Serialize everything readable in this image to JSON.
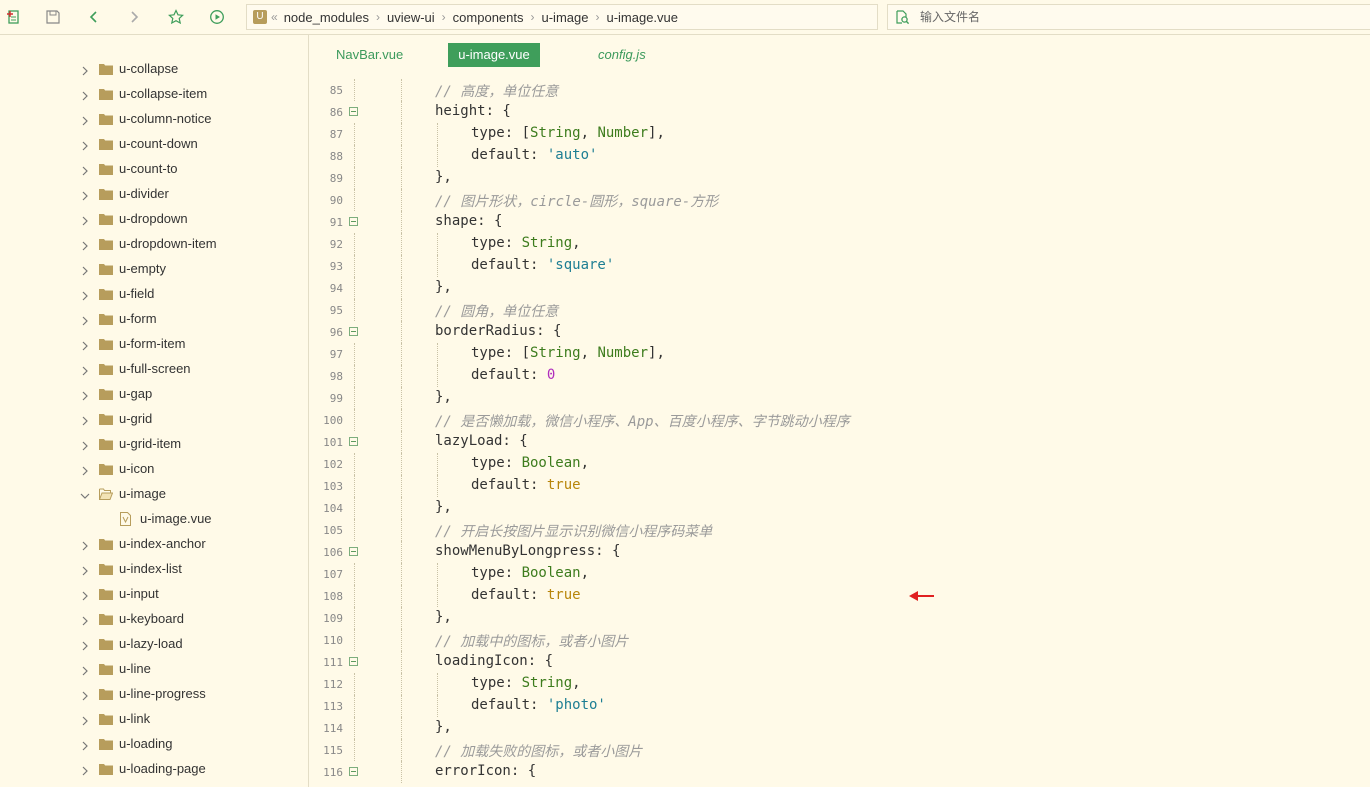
{
  "toolbar": {
    "icons": [
      "new-file-icon",
      "save-icon",
      "back-icon",
      "forward-icon",
      "favorite-icon",
      "run-icon"
    ]
  },
  "breadcrumb": {
    "icon": "u-logo-icon",
    "lead": "«",
    "items": [
      "node_modules",
      "uview-ui",
      "components",
      "u-image",
      "u-image.vue"
    ]
  },
  "search": {
    "placeholder": "输入文件名",
    "value": ""
  },
  "colors": {
    "background": "#fffae8",
    "active_tab": "#3f9e5b",
    "tab_text": "#3c9a5c",
    "comment": "#9a9a9a",
    "type": "#3d7c1d",
    "string": "#1d7e93",
    "boolean": "#b8860b",
    "number": "#b02dbd",
    "arrow": "#e02020"
  },
  "sidebar": {
    "items": [
      {
        "label": "u-collapse"
      },
      {
        "label": "u-collapse-item"
      },
      {
        "label": "u-column-notice"
      },
      {
        "label": "u-count-down"
      },
      {
        "label": "u-count-to"
      },
      {
        "label": "u-divider"
      },
      {
        "label": "u-dropdown"
      },
      {
        "label": "u-dropdown-item"
      },
      {
        "label": "u-empty"
      },
      {
        "label": "u-field"
      },
      {
        "label": "u-form"
      },
      {
        "label": "u-form-item"
      },
      {
        "label": "u-full-screen"
      },
      {
        "label": "u-gap"
      },
      {
        "label": "u-grid"
      },
      {
        "label": "u-grid-item"
      },
      {
        "label": "u-icon"
      },
      {
        "label": "u-image",
        "expanded": true
      },
      {
        "label": "u-image.vue",
        "file": true
      },
      {
        "label": "u-index-anchor"
      },
      {
        "label": "u-index-list"
      },
      {
        "label": "u-input"
      },
      {
        "label": "u-keyboard"
      },
      {
        "label": "u-lazy-load"
      },
      {
        "label": "u-line"
      },
      {
        "label": "u-line-progress"
      },
      {
        "label": "u-link"
      },
      {
        "label": "u-loading"
      },
      {
        "label": "u-loading-page"
      }
    ]
  },
  "tabs": [
    {
      "label": "NavBar.vue",
      "active": false
    },
    {
      "label": "u-image.vue",
      "active": true
    },
    {
      "label": "config.js",
      "active": false,
      "italic": true
    }
  ],
  "code": [
    {
      "n": "85",
      "fold": false,
      "indent": 1,
      "tokens": [
        {
          "t": "// 高度，单位任意",
          "c": "cm"
        }
      ]
    },
    {
      "n": "86",
      "fold": true,
      "indent": 1,
      "tokens": [
        {
          "t": "height: {"
        }
      ]
    },
    {
      "n": "87",
      "fold": false,
      "indent": 2,
      "tokens": [
        {
          "t": "type: ["
        },
        {
          "t": "String",
          "c": "ty"
        },
        {
          "t": ", "
        },
        {
          "t": "Number",
          "c": "ty"
        },
        {
          "t": "],"
        }
      ]
    },
    {
      "n": "88",
      "fold": false,
      "indent": 2,
      "tokens": [
        {
          "t": "default: "
        },
        {
          "t": "'auto'",
          "c": "st"
        }
      ]
    },
    {
      "n": "89",
      "fold": false,
      "indent": 1,
      "tokens": [
        {
          "t": "},"
        }
      ]
    },
    {
      "n": "90",
      "fold": false,
      "indent": 1,
      "tokens": [
        {
          "t": "// 图片形状，circle-圆形，square-方形",
          "c": "cm"
        }
      ]
    },
    {
      "n": "91",
      "fold": true,
      "indent": 1,
      "tokens": [
        {
          "t": "shape: {"
        }
      ]
    },
    {
      "n": "92",
      "fold": false,
      "indent": 2,
      "tokens": [
        {
          "t": "type: "
        },
        {
          "t": "String",
          "c": "ty"
        },
        {
          "t": ","
        }
      ]
    },
    {
      "n": "93",
      "fold": false,
      "indent": 2,
      "tokens": [
        {
          "t": "default: "
        },
        {
          "t": "'square'",
          "c": "st"
        }
      ]
    },
    {
      "n": "94",
      "fold": false,
      "indent": 1,
      "tokens": [
        {
          "t": "},"
        }
      ]
    },
    {
      "n": "95",
      "fold": false,
      "indent": 1,
      "tokens": [
        {
          "t": "// 圆角，单位任意",
          "c": "cm"
        }
      ]
    },
    {
      "n": "96",
      "fold": true,
      "indent": 1,
      "tokens": [
        {
          "t": "borderRadius: {"
        }
      ]
    },
    {
      "n": "97",
      "fold": false,
      "indent": 2,
      "tokens": [
        {
          "t": "type: ["
        },
        {
          "t": "String",
          "c": "ty"
        },
        {
          "t": ", "
        },
        {
          "t": "Number",
          "c": "ty"
        },
        {
          "t": "],"
        }
      ]
    },
    {
      "n": "98",
      "fold": false,
      "indent": 2,
      "tokens": [
        {
          "t": "default: "
        },
        {
          "t": "0",
          "c": "nu"
        }
      ]
    },
    {
      "n": "99",
      "fold": false,
      "indent": 1,
      "tokens": [
        {
          "t": "},"
        }
      ]
    },
    {
      "n": "100",
      "fold": false,
      "indent": 1,
      "tokens": [
        {
          "t": "// 是否懒加载，微信小程序、App、百度小程序、字节跳动小程序",
          "c": "cm"
        }
      ]
    },
    {
      "n": "101",
      "fold": true,
      "indent": 1,
      "tokens": [
        {
          "t": "lazyLoad: {"
        }
      ]
    },
    {
      "n": "102",
      "fold": false,
      "indent": 2,
      "tokens": [
        {
          "t": "type: "
        },
        {
          "t": "Boolean",
          "c": "ty"
        },
        {
          "t": ","
        }
      ]
    },
    {
      "n": "103",
      "fold": false,
      "indent": 2,
      "tokens": [
        {
          "t": "default: "
        },
        {
          "t": "true",
          "c": "bo"
        }
      ]
    },
    {
      "n": "104",
      "fold": false,
      "indent": 1,
      "tokens": [
        {
          "t": "},"
        }
      ]
    },
    {
      "n": "105",
      "fold": false,
      "indent": 1,
      "tokens": [
        {
          "t": "// 开启长按图片显示识别微信小程序码菜单",
          "c": "cm"
        }
      ]
    },
    {
      "n": "106",
      "fold": true,
      "indent": 1,
      "tokens": [
        {
          "t": "showMenuByLongpress: {"
        }
      ]
    },
    {
      "n": "107",
      "fold": false,
      "indent": 2,
      "tokens": [
        {
          "t": "type: "
        },
        {
          "t": "Boolean",
          "c": "ty"
        },
        {
          "t": ","
        }
      ]
    },
    {
      "n": "108",
      "fold": false,
      "indent": 2,
      "arrow": true,
      "tokens": [
        {
          "t": "default: "
        },
        {
          "t": "true",
          "c": "bo"
        }
      ]
    },
    {
      "n": "109",
      "fold": false,
      "indent": 1,
      "tokens": [
        {
          "t": "},"
        }
      ]
    },
    {
      "n": "110",
      "fold": false,
      "indent": 1,
      "tokens": [
        {
          "t": "// 加载中的图标，或者小图片",
          "c": "cm"
        }
      ]
    },
    {
      "n": "111",
      "fold": true,
      "indent": 1,
      "tokens": [
        {
          "t": "loadingIcon: {"
        }
      ]
    },
    {
      "n": "112",
      "fold": false,
      "indent": 2,
      "tokens": [
        {
          "t": "type: "
        },
        {
          "t": "String",
          "c": "ty"
        },
        {
          "t": ","
        }
      ]
    },
    {
      "n": "113",
      "fold": false,
      "indent": 2,
      "tokens": [
        {
          "t": "default: "
        },
        {
          "t": "'photo'",
          "c": "st"
        }
      ]
    },
    {
      "n": "114",
      "fold": false,
      "indent": 1,
      "tokens": [
        {
          "t": "},"
        }
      ]
    },
    {
      "n": "115",
      "fold": false,
      "indent": 1,
      "tokens": [
        {
          "t": "// 加载失败的图标，或者小图片",
          "c": "cm"
        }
      ]
    },
    {
      "n": "116",
      "fold": true,
      "indent": 1,
      "tokens": [
        {
          "t": "errorIcon: {"
        }
      ]
    }
  ]
}
